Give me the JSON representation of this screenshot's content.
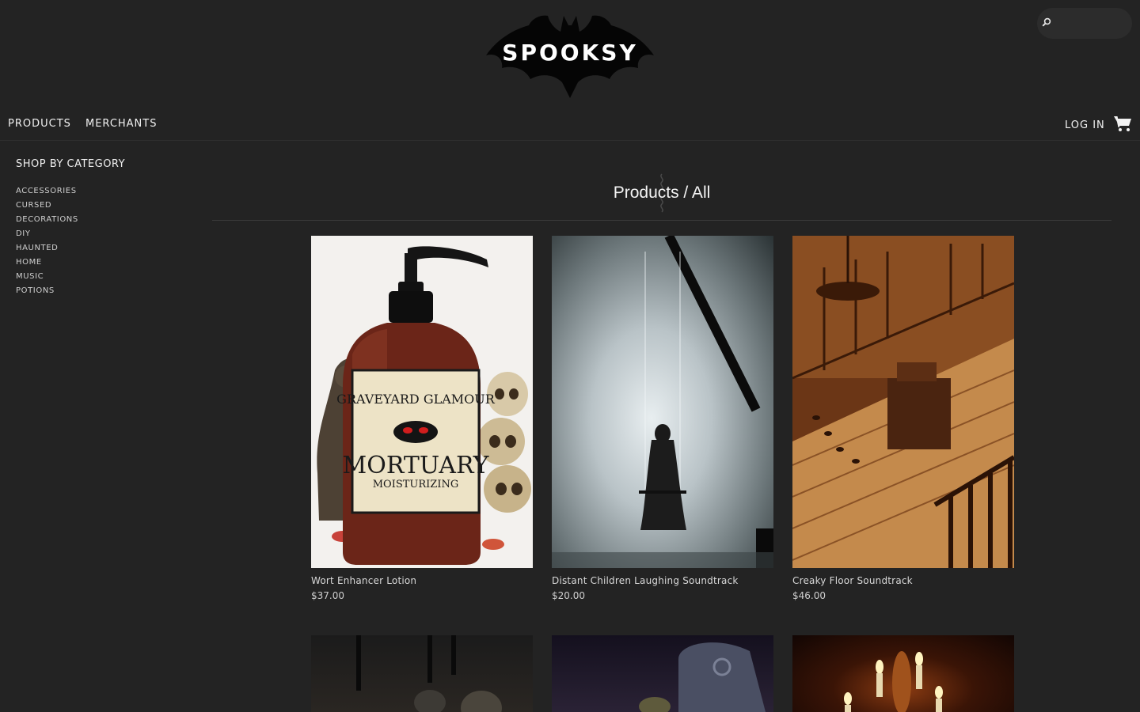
{
  "header": {
    "logo_text": "SPOOKSY",
    "search_placeholder": "",
    "nav": {
      "products": "PRODUCTS",
      "merchants": "MERCHANTS",
      "login": "LOG IN"
    }
  },
  "sidebar": {
    "title": "SHOP BY CATEGORY",
    "categories": [
      "ACCESSORIES",
      "CURSED",
      "DECORATIONS",
      "DIY",
      "HAUNTED",
      "HOME",
      "MUSIC",
      "POTIONS"
    ]
  },
  "main": {
    "page_title": "Products / All",
    "products": [
      {
        "name": "Wort Enhancer Lotion",
        "price": "$37.00",
        "label_line1": "GRAVEYARD GLAMOUR",
        "label_line2": "MORTUARY",
        "label_line3": "MOISTURIZING"
      },
      {
        "name": "Distant Children Laughing Soundtrack",
        "price": "$20.00"
      },
      {
        "name": "Creaky Floor Soundtrack",
        "price": "$46.00"
      }
    ]
  },
  "colors": {
    "background": "#232323",
    "text": "#e6e6e6",
    "divider": "#3a3a3a"
  },
  "icons": [
    "bat-logo-icon",
    "search-icon",
    "cart-icon",
    "ornament-icon"
  ]
}
